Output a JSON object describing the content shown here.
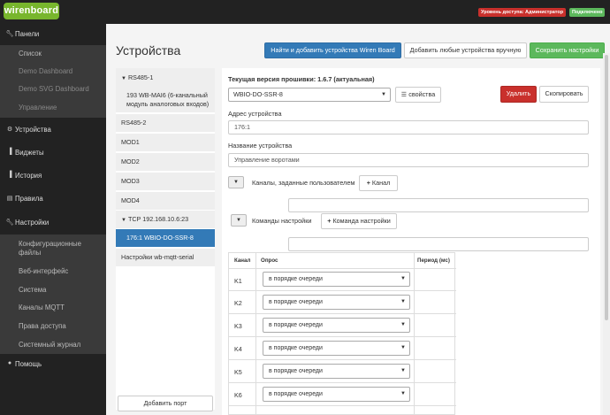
{
  "header": {
    "logo_text": "wirenboard",
    "access_badge": "Уровень доступа: Администратор",
    "connection_badge": "Подключено"
  },
  "sidebar": {
    "panels": "Панели",
    "panels_items": [
      "Список",
      "Demo Dashboard",
      "Demo SVG Dashboard",
      "Управление"
    ],
    "devices": "Устройства",
    "widgets": "Виджеты",
    "history": "История",
    "rules": "Правила",
    "settings": "Настройки",
    "settings_items": [
      "Конфигурационные",
      "файлы",
      "Веб-интерфейс",
      "Система",
      "Каналы MQTT",
      "Права доступа",
      "Системный журнал"
    ],
    "help": "Помощь"
  },
  "main": {
    "title": "Устройства",
    "btn_find": "Найти и добавить устройства Wiren Board",
    "btn_add_any": "Добавить любые устройства вручную",
    "btn_save": "Сохранить настройки"
  },
  "ports": {
    "rs485_1": "RS485-1",
    "rs485_1_device_line1": "193 WB-MAI6 (6-канальный",
    "rs485_1_device_line2": "модуль аналоговых входов)",
    "rs485_2": "RS485-2",
    "mod1": "MOD1",
    "mod2": "MOD2",
    "mod3": "MOD3",
    "mod4": "MOD4",
    "tcp": "TCP 192.168.10.6:23",
    "tcp_device": "176:1 WBIO-DO-SSR-8",
    "mqtt_serial": "Настройки wb-mqtt-serial",
    "add_port": "Добавить порт"
  },
  "device": {
    "firmware": "Текущая версия прошивки: 1.6.7 (актуальная)",
    "type_value": "WBIO-DO-SSR-8",
    "btn_props": "свойства",
    "btn_delete": "Удалить",
    "btn_copy": "Скопировать",
    "address_label": "Адрес устройства",
    "address_value": "176:1",
    "name_label": "Название устройства",
    "name_value": "Управление воротами",
    "user_channels_label": "Каналы, заданные пользователем",
    "btn_add_channel": "Канал",
    "commands_label": "Команды настройки",
    "btn_add_command": "Команда настройки"
  },
  "table": {
    "headers": [
      "Канал",
      "Опрос",
      "Период (мс)"
    ],
    "rows": [
      {
        "channel": "K1",
        "poll": "в порядке очереди"
      },
      {
        "channel": "K2",
        "poll": "в порядке очереди"
      },
      {
        "channel": "K3",
        "poll": "в порядке очереди"
      },
      {
        "channel": "K4",
        "poll": "в порядке очереди"
      },
      {
        "channel": "K5",
        "poll": "в порядке очереди"
      },
      {
        "channel": "K6",
        "poll": "в порядке очереди"
      }
    ]
  },
  "icons": {
    "panels": "wrench-icon",
    "devices": "gear-icon",
    "widgets": "bar-chart-icon",
    "history": "bar-chart-icon",
    "rules": "document-icon",
    "settings": "wrench-icon",
    "help": "question-circle-icon"
  }
}
